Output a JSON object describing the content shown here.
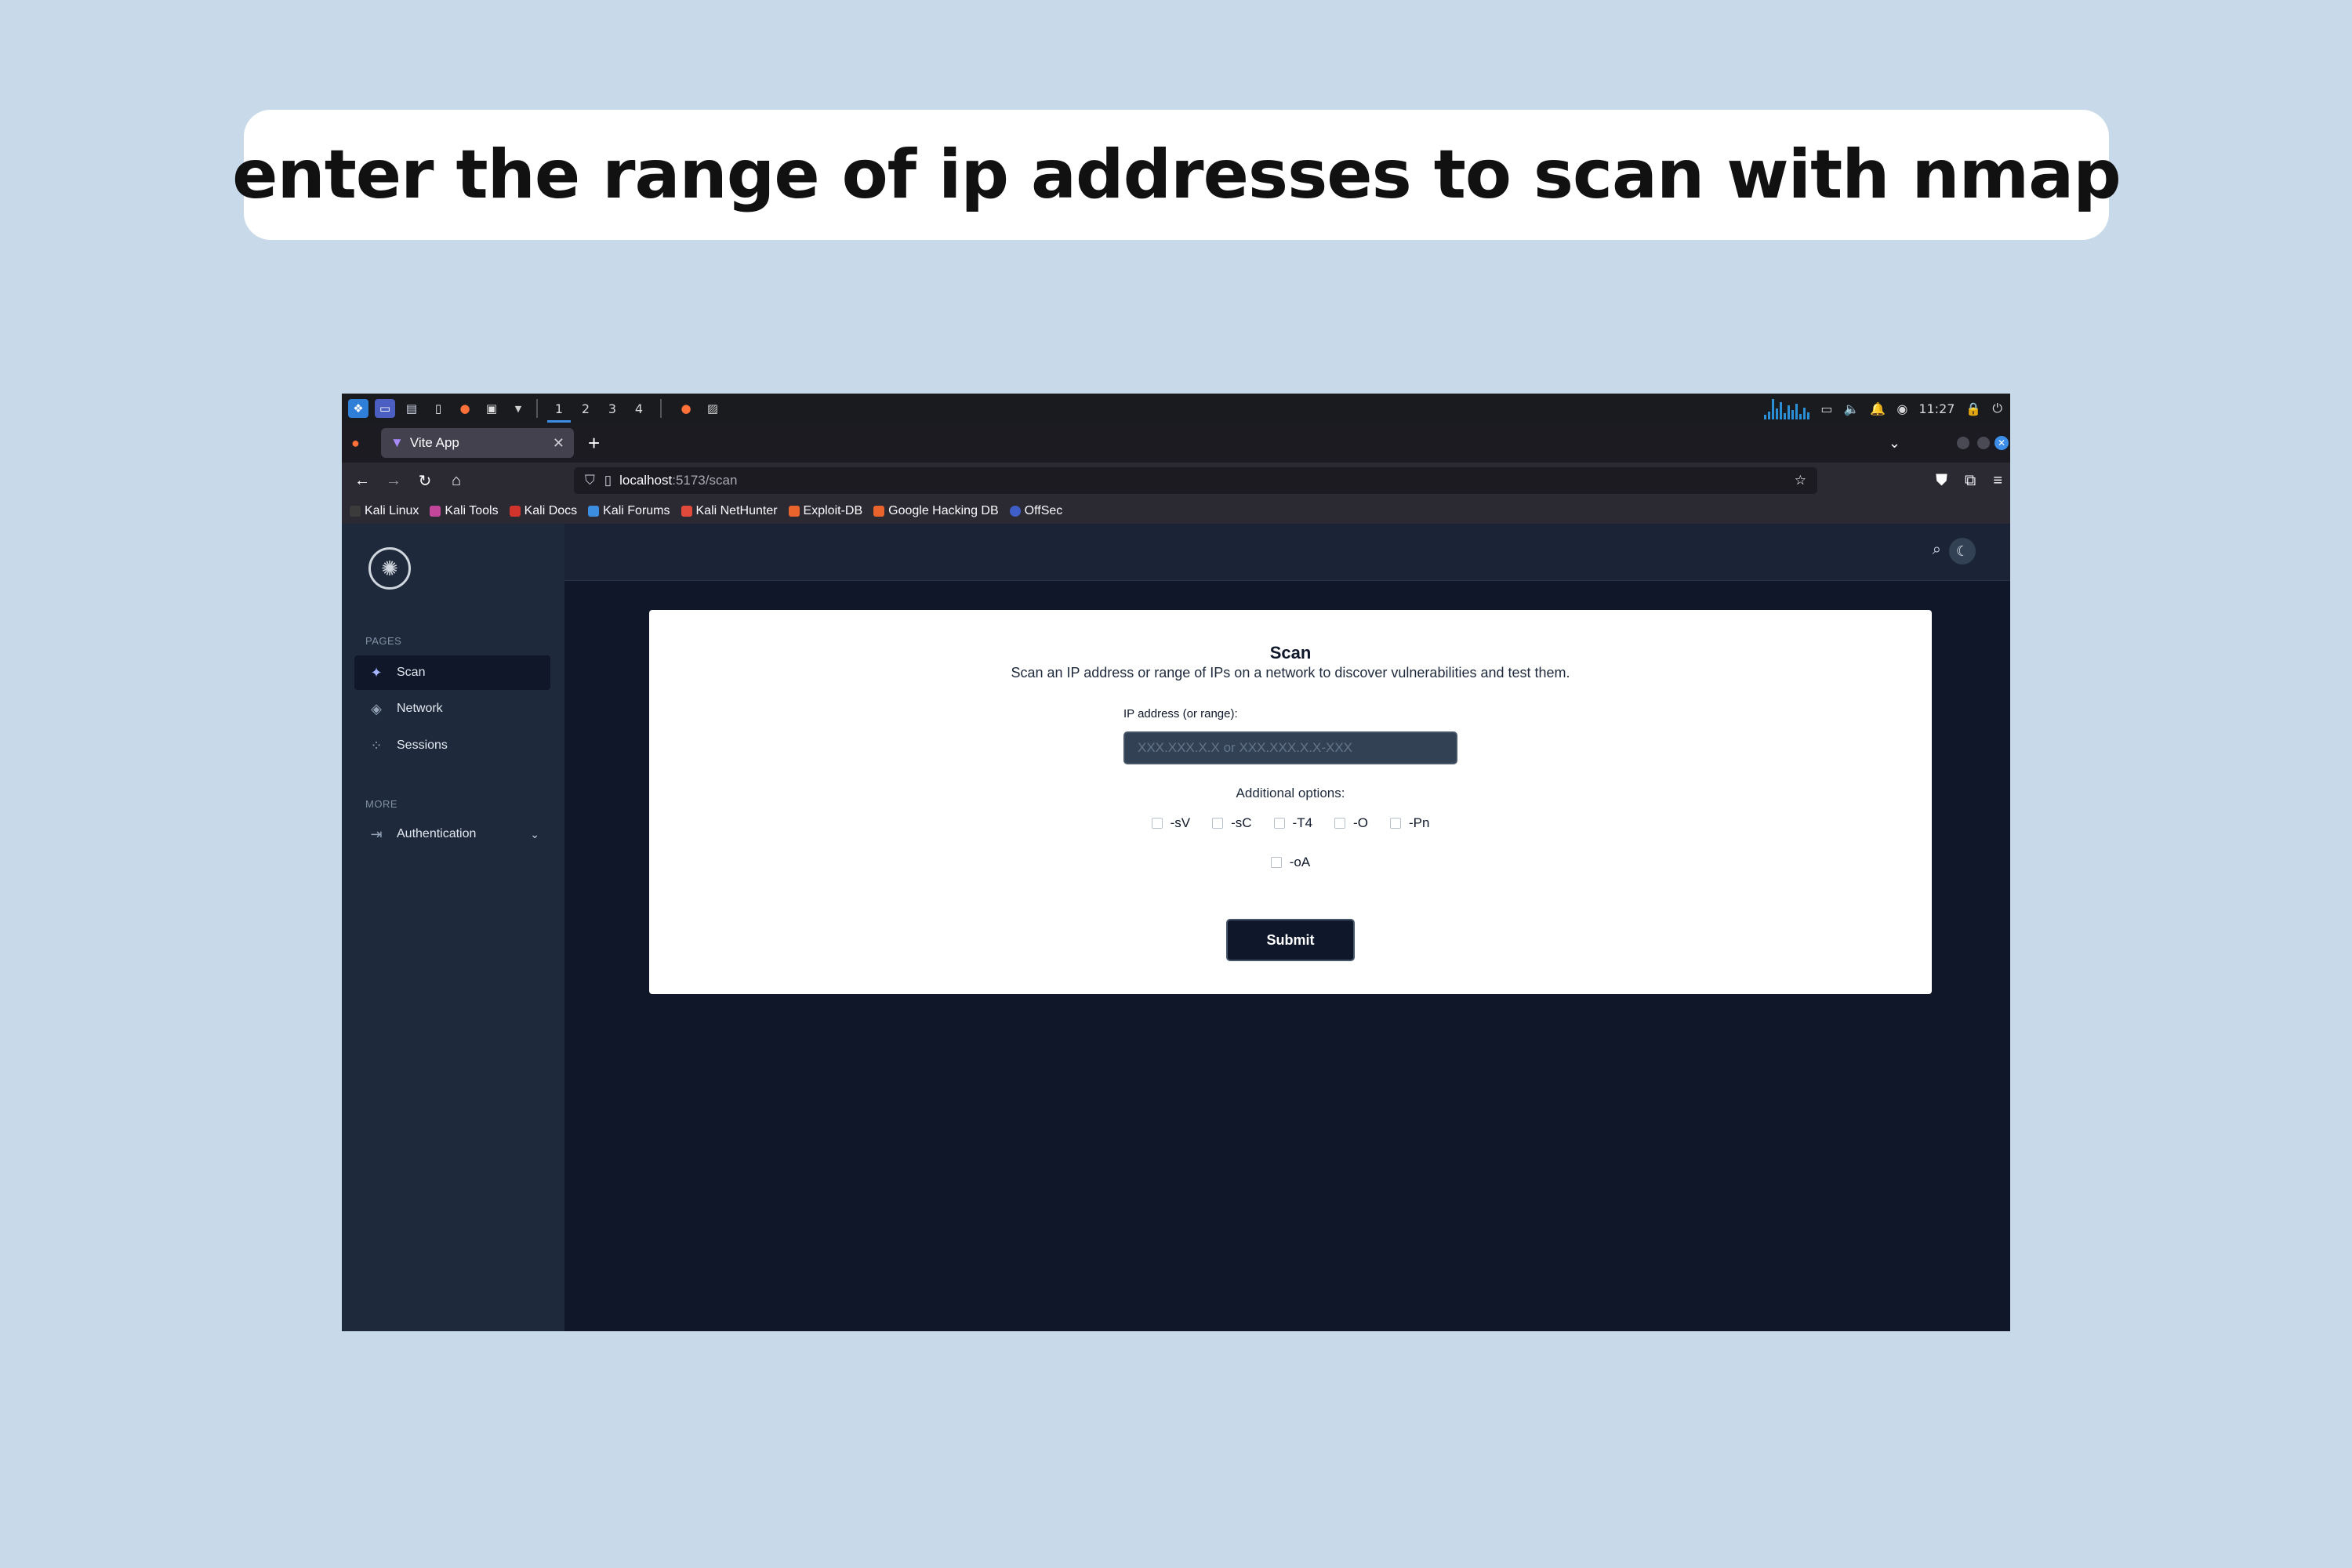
{
  "caption": "enter the range of ip addresses to scan with nmap",
  "taskbar": {
    "workspaces": [
      "1",
      "2",
      "3",
      "4"
    ],
    "active_workspace": "1",
    "clock": "11:27"
  },
  "browser": {
    "tab_title": "Vite App",
    "url_host": "localhost",
    "url_path": ":5173/scan",
    "bookmarks": [
      "Kali Linux",
      "Kali Tools",
      "Kali Docs",
      "Kali Forums",
      "Kali NetHunter",
      "Exploit-DB",
      "Google Hacking DB",
      "OffSec"
    ]
  },
  "sidebar": {
    "pages_label": "PAGES",
    "items": [
      {
        "label": "Scan",
        "icon": "sparkles-icon",
        "active": true
      },
      {
        "label": "Network",
        "icon": "network-icon",
        "active": false
      },
      {
        "label": "Sessions",
        "icon": "sessions-icon",
        "active": false
      }
    ],
    "more_label": "MORE",
    "auth_label": "Authentication"
  },
  "scan_form": {
    "title": "Scan",
    "subtitle": "Scan an IP address or range of IPs on a network to discover vulnerabilities and test them.",
    "ip_label": "IP address (or range):",
    "ip_placeholder": "XXX.XXX.X.X or XXX.XXX.X.X-XXX",
    "ip_value": "",
    "options_label": "Additional options:",
    "options_row1": [
      "-sV",
      "-sC",
      "-T4",
      "-O",
      "-Pn"
    ],
    "options_row2": [
      "-oA"
    ],
    "submit_label": "Submit"
  },
  "colors": {
    "page_background": "#c8daea",
    "app_background": "#0f1729",
    "sidebar": "#1e293b",
    "card": "#ffffff",
    "button": "#0f172a",
    "accent": "#3d8ee8"
  }
}
